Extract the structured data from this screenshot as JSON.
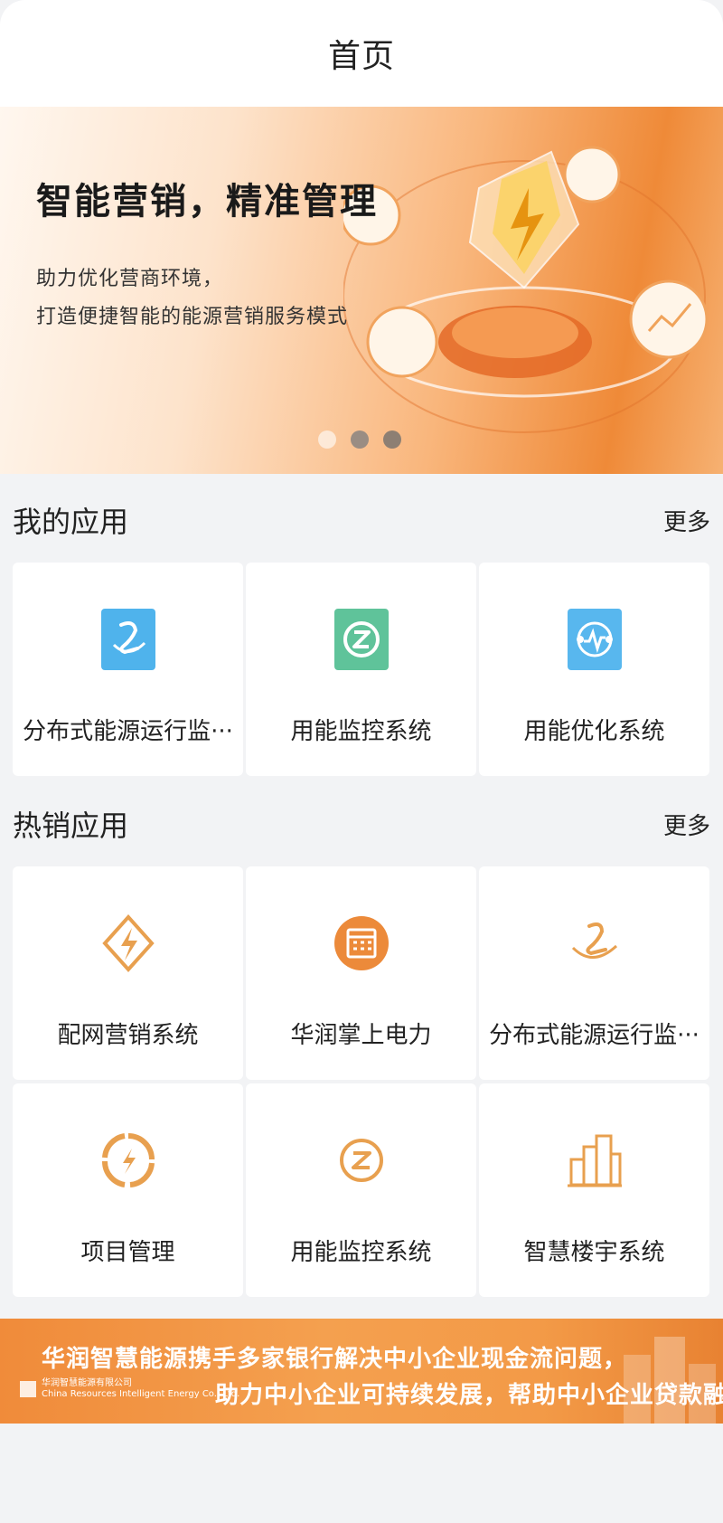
{
  "header": {
    "title": "首页"
  },
  "banner": {
    "title": "智能营销，精准管理",
    "subtitle_line1": "助力优化营商环境，",
    "subtitle_line2": "打造便捷智能的能源营销服务模式",
    "page_count": 3,
    "active_page": 2
  },
  "my_apps": {
    "title": "我的应用",
    "more": "更多",
    "items": [
      {
        "label": "分布式能源运行监···",
        "icon": "distributed-energy-icon",
        "color": "#4fb3ec"
      },
      {
        "label": "用能监控系统",
        "icon": "energy-monitor-icon",
        "color": "#5fc39a"
      },
      {
        "label": "用能优化系统",
        "icon": "energy-optimize-icon",
        "color": "#58b7ee"
      }
    ]
  },
  "hot_apps": {
    "title": "热销应用",
    "more": "更多",
    "items": [
      {
        "label": "配网营销系统",
        "icon": "lightning-diamond-icon",
        "color": "#e8a04f"
      },
      {
        "label": "华润掌上电力",
        "icon": "calendar-icon",
        "color": "#ec8a3a"
      },
      {
        "label": "分布式能源运行监···",
        "icon": "distributed-energy-icon",
        "color": "#e8a04f"
      },
      {
        "label": "项目管理",
        "icon": "project-icon",
        "color": "#e8a04f"
      },
      {
        "label": "用能监控系统",
        "icon": "energy-monitor-icon",
        "color": "#e8a04f"
      },
      {
        "label": "智慧楼宇系统",
        "icon": "building-icon",
        "color": "#e8a04f"
      }
    ]
  },
  "ad": {
    "line1": "华润智慧能源携手多家银行解决中小企业现金流问题，",
    "line2": "助力中小企业可持续发展，帮助中小企业贷款融资。",
    "company_cn": "华润智慧能源有限公司",
    "company_en": "China Resources Intelligent Energy Co., Ltd."
  }
}
